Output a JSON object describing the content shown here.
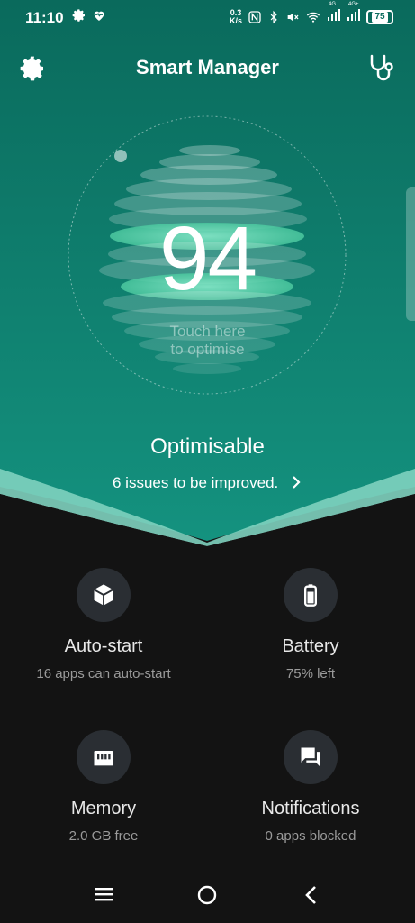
{
  "status": {
    "time": "11:10",
    "speed_value": "0.3",
    "speed_unit": "K/s",
    "net_label_1": "4G",
    "net_label_2": "4G+",
    "battery": "75"
  },
  "header": {
    "title": "Smart Manager"
  },
  "score": {
    "value": "94",
    "touch_line1": "Touch here",
    "touch_line2": "to optimise",
    "status": "Optimisable",
    "issues": "6 issues to be improved."
  },
  "features": [
    {
      "name": "Auto-start",
      "sub": "16 apps can auto-start",
      "icon": "cube-icon"
    },
    {
      "name": "Battery",
      "sub": "75% left",
      "icon": "battery-icon"
    },
    {
      "name": "Memory",
      "sub": "2.0 GB free",
      "icon": "memory-chip-icon"
    },
    {
      "name": "Notifications",
      "sub": "0 apps blocked",
      "icon": "chat-bubbles-icon"
    }
  ],
  "colors": {
    "hero_top": "#0a6a5c",
    "hero_bottom": "#13907d",
    "wave": "#7fd1bf",
    "background": "#131313",
    "icon_circle": "#2a2e33"
  }
}
